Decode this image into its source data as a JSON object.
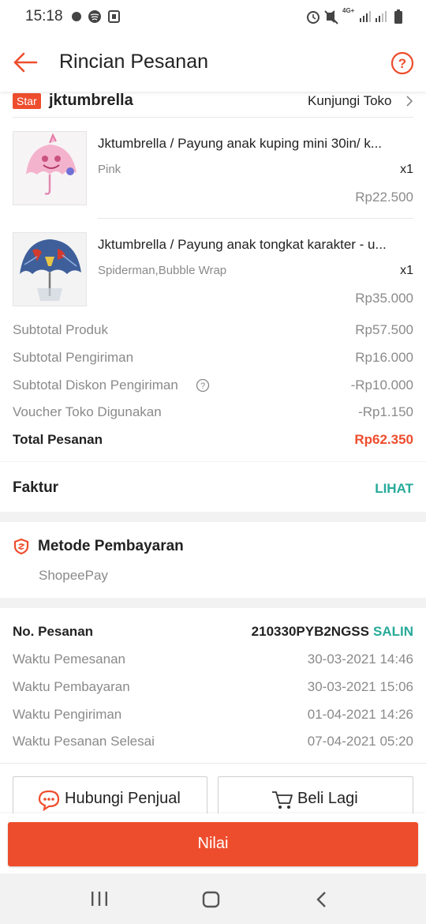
{
  "status_bar": {
    "time": "15:18",
    "network": "4G+"
  },
  "header": {
    "title": "Rincian Pesanan"
  },
  "shop": {
    "badge": "Star",
    "name": "jktumbrella",
    "visit_label": "Kunjungi Toko"
  },
  "products": [
    {
      "name": "Jktumbrella / Payung anak kuping mini 30in/ k...",
      "variant": "Pink",
      "qty": "x1",
      "price": "Rp22.500"
    },
    {
      "name": "Jktumbrella / Payung anak tongkat karakter - u...",
      "variant": "Spiderman,Bubble Wrap",
      "qty": "x1",
      "price": "Rp35.000"
    }
  ],
  "summary": [
    {
      "label": "Subtotal Produk",
      "value": "Rp57.500"
    },
    {
      "label": "Subtotal Pengiriman",
      "value": "Rp16.000"
    },
    {
      "label": "Subtotal Diskon Pengiriman",
      "value": "-Rp10.000"
    },
    {
      "label": "Voucher Toko Digunakan",
      "value": "-Rp1.150"
    }
  ],
  "total": {
    "label": "Total Pesanan",
    "value": "Rp62.350"
  },
  "invoice": {
    "label": "Faktur",
    "action": "LIHAT"
  },
  "payment": {
    "title": "Metode Pembayaran",
    "method": "ShopeePay"
  },
  "order": {
    "number_label": "No. Pesanan",
    "number": "210330PYB2NGSS",
    "copy": "SALIN",
    "times": [
      {
        "label": "Waktu Pemesanan",
        "value": "30-03-2021 14:46"
      },
      {
        "label": "Waktu Pembayaran",
        "value": "30-03-2021 15:06"
      },
      {
        "label": "Waktu Pengiriman",
        "value": "01-04-2021 14:26"
      },
      {
        "label": "Waktu Pesanan Selesai",
        "value": "07-04-2021 05:20"
      }
    ]
  },
  "actions": {
    "contact_seller": "Hubungi Penjual",
    "buy_again": "Beli Lagi",
    "rate": "Nilai"
  },
  "colors": {
    "accent": "#ee4d2d",
    "teal": "#26aa99",
    "background": "#f2f2f2"
  }
}
